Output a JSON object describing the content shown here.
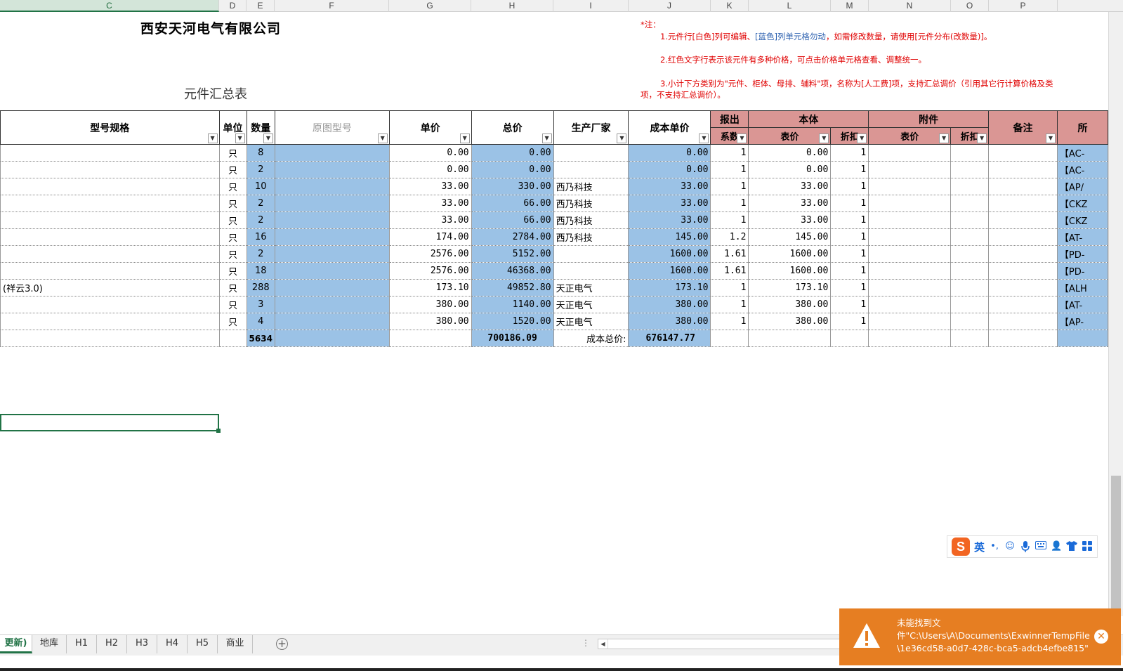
{
  "columns": [
    "C",
    "D",
    "E",
    "F",
    "G",
    "H",
    "I",
    "J",
    "K",
    "L",
    "M",
    "N",
    "O",
    "P"
  ],
  "header_block": {
    "company": "西安天河电气有限公司",
    "title": "元件汇总表",
    "note_title": "*注：",
    "note_1a": "1.元件行[白色]列可编辑、",
    "note_1b": "[蓝色]列单元格勿动",
    "note_1c": "，如需修改数量，请使用[元件分布(改数量)]。",
    "note_2": "2.红色文字行表示该元件有多种价格，可点击价格单元格查看、调整统一。",
    "note_3a": "3.小计下方类别为\"元件、柜体、母排、辅料\"项，名称为[人工费]项，支持汇总调价（引用其它行计算价格及类",
    "note_3b": "项，不支持汇总调价）。"
  },
  "table_headers": {
    "model": "型号规格",
    "unit": "单位",
    "qty": "数量",
    "orig_model": "原图型号",
    "unit_price": "单价",
    "total_price": "总价",
    "manufacturer": "生产厂家",
    "cost_price": "成本单价",
    "quote_1": "报出",
    "quote_2": "系数",
    "body": "本体",
    "attachment": "附件",
    "list_price": "表价",
    "discount": "折扣",
    "att_list_price": "表价",
    "att_discount": "折扣",
    "remark": "备注",
    "extra": "所"
  },
  "rows": [
    {
      "model": "",
      "unit": "只",
      "qty": "8",
      "unit_price": "0.00",
      "total": "0.00",
      "maker": "",
      "cost": "0.00",
      "coef": "1",
      "list": "0.00",
      "disc": "1",
      "extra": "【AC-"
    },
    {
      "model": "",
      "unit": "只",
      "qty": "2",
      "unit_price": "0.00",
      "total": "0.00",
      "maker": "",
      "cost": "0.00",
      "coef": "1",
      "list": "0.00",
      "disc": "1",
      "extra": "【AC-"
    },
    {
      "model": "",
      "unit": "只",
      "qty": "10",
      "unit_price": "33.00",
      "total": "330.00",
      "maker": "西乃科技",
      "cost": "33.00",
      "coef": "1",
      "list": "33.00",
      "disc": "1",
      "extra": "【AP/"
    },
    {
      "model": "",
      "unit": "只",
      "qty": "2",
      "unit_price": "33.00",
      "total": "66.00",
      "maker": "西乃科技",
      "cost": "33.00",
      "coef": "1",
      "list": "33.00",
      "disc": "1",
      "extra": "【CKZ"
    },
    {
      "model": "",
      "unit": "只",
      "qty": "2",
      "unit_price": "33.00",
      "total": "66.00",
      "maker": "西乃科技",
      "cost": "33.00",
      "coef": "1",
      "list": "33.00",
      "disc": "1",
      "extra": "【CKZ"
    },
    {
      "model": "",
      "unit": "只",
      "qty": "16",
      "unit_price": "174.00",
      "total": "2784.00",
      "maker": "西乃科技",
      "cost": "145.00",
      "coef": "1.2",
      "list": "145.00",
      "disc": "1",
      "extra": "【AT-"
    },
    {
      "model": "",
      "unit": "只",
      "qty": "2",
      "unit_price": "2576.00",
      "total": "5152.00",
      "maker": "",
      "cost": "1600.00",
      "coef": "1.61",
      "list": "1600.00",
      "disc": "1",
      "extra": "【PD-"
    },
    {
      "model": "",
      "unit": "只",
      "qty": "18",
      "unit_price": "2576.00",
      "total": "46368.00",
      "maker": "",
      "cost": "1600.00",
      "coef": "1.61",
      "list": "1600.00",
      "disc": "1",
      "extra": "【PD-"
    },
    {
      "model": "(祥云3.0)",
      "unit": "只",
      "qty": "288",
      "unit_price": "173.10",
      "total": "49852.80",
      "maker": "天正电气",
      "cost": "173.10",
      "coef": "1",
      "list": "173.10",
      "disc": "1",
      "extra": "【ALH"
    },
    {
      "model": "",
      "unit": "只",
      "qty": "3",
      "unit_price": "380.00",
      "total": "1140.00",
      "maker": "天正电气",
      "cost": "380.00",
      "coef": "1",
      "list": "380.00",
      "disc": "1",
      "extra": "【AT-"
    },
    {
      "model": "",
      "unit": "只",
      "qty": "4",
      "unit_price": "380.00",
      "total": "1520.00",
      "maker": "天正电气",
      "cost": "380.00",
      "coef": "1",
      "list": "380.00",
      "disc": "1",
      "extra": "【AP-"
    }
  ],
  "totals": {
    "qty": "5634",
    "total_price": "700186.09",
    "cost_label": "成本总价:",
    "cost_total": "676147.77"
  },
  "ime": {
    "text": "英",
    "logo": "S"
  },
  "tabs": [
    "更新)",
    "地库",
    "H1",
    "H2",
    "H3",
    "H4",
    "H5",
    "商业"
  ],
  "toast": {
    "line1": "未能找到文",
    "line2": "件\"C:\\Users\\A\\Documents\\ExwinnerTempFile",
    "line3": "\\1e36cd58-a0d7-428c-bca5-adcb4efbe815\""
  },
  "colors": {
    "accent": "#217346",
    "blue_cell": "#9bc2e6",
    "pink_header": "#da9694",
    "toast": "#e67e22",
    "note_red": "#e00000"
  }
}
